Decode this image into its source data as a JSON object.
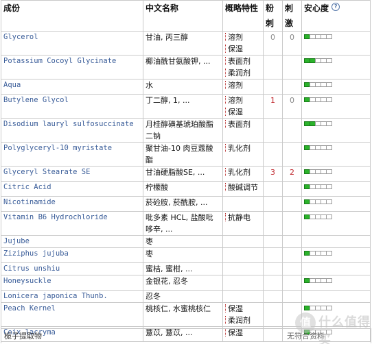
{
  "header": {
    "col_ingredient": "成份",
    "col_chinese": "中文名称",
    "col_category": "概略特性",
    "col_acne": "粉刺",
    "col_irritant": "刺激",
    "col_safety": "安心度",
    "help_icon": "?"
  },
  "colors": {
    "bar_on": "#2bb32b",
    "bar_off": "#ffffff",
    "link": "#3a5d99",
    "alert_number": "#c0282e"
  },
  "rows": [
    {
      "en": "Glycerol",
      "cn": "甘油, 丙三醇",
      "cat": [
        "溶剂",
        "保湿"
      ],
      "acne": "0",
      "irritant": "0",
      "acne_hi": false,
      "irr_hi": false,
      "safety": 1,
      "tall": true
    },
    {
      "en": "Potassium Cocoyl Glycinate",
      "cn": "椰油酰甘氨酸钾, ...",
      "cat": [
        "表面剂",
        "柔润剂"
      ],
      "acne": "",
      "irritant": "",
      "safety": 2,
      "tall": true
    },
    {
      "en": "Aqua",
      "cn": "水",
      "cat": [
        "溶剂"
      ],
      "acne": "",
      "irritant": "",
      "safety": 1,
      "tall": false
    },
    {
      "en": "Butylene Glycol",
      "cn": "丁二醇, 1, ...",
      "cat": [
        "溶剂",
        "保湿"
      ],
      "acne": "1",
      "irritant": "0",
      "acne_hi": true,
      "irr_hi": false,
      "safety": 1,
      "tall": true
    },
    {
      "en": "Disodium lauryl sulfosuccinate",
      "cn": "月桂醇磺基琥珀酸酯二钠",
      "cat": [
        "表面剂"
      ],
      "acne": "",
      "irritant": "",
      "safety": 2,
      "tall": true
    },
    {
      "en": "Polyglyceryl-10 myristate",
      "cn": "聚甘油-10 肉豆蔻酸酯",
      "cat": [
        "乳化剂"
      ],
      "acne": "",
      "irritant": "",
      "safety": 1,
      "tall": false
    },
    {
      "en": "Glyceryl Stearate SE",
      "cn": "甘油硬脂酸SE, ...",
      "cat": [
        "乳化剂"
      ],
      "acne": "3",
      "irritant": "2",
      "acne_hi": true,
      "irr_hi": true,
      "safety": 1,
      "tall": false
    },
    {
      "en": "Citric Acid",
      "cn": "柠檬酸",
      "cat": [
        "酸碱调节"
      ],
      "acne": "",
      "irritant": "",
      "safety": 1,
      "tall": false
    },
    {
      "en": "Nicotinamide",
      "cn": "菸硷胺, 菸酰胺, ...",
      "cat": [],
      "acne": "",
      "irritant": "",
      "safety": 1,
      "tall": false
    },
    {
      "en": "Vitamin B6 Hydrochloride",
      "cn": "吡多素 HCL, 盐酸吡哆辛, ...",
      "cat": [
        "抗静电"
      ],
      "acne": "",
      "irritant": "",
      "safety": 1,
      "tall": true
    },
    {
      "en": "Jujube",
      "cn": "枣",
      "cat": [],
      "acne": "",
      "irritant": "",
      "safety": 0,
      "tall": false
    },
    {
      "en": "Ziziphus jujuba",
      "cn": "枣",
      "cat": [],
      "acne": "",
      "irritant": "",
      "safety": 1,
      "tall": false
    },
    {
      "en": "Citrus unshiu",
      "cn": "蜜桔, 蜜柑, ...",
      "cat": [],
      "acne": "",
      "irritant": "",
      "safety": 0,
      "tall": false
    },
    {
      "en": "Honeysuckle",
      "cn": "金银花, 忍冬",
      "cat": [],
      "acne": "",
      "irritant": "",
      "safety": 1,
      "tall": false
    },
    {
      "en": "Lonicera japonica Thunb.",
      "cn": "忍冬",
      "cat": [],
      "acne": "",
      "irritant": "",
      "safety": 0,
      "tall": false
    },
    {
      "en": "Peach Kernel",
      "cn": "桃核仁, 水蜜桃核仁",
      "cat": [
        "保湿",
        "柔润剂"
      ],
      "acne": "",
      "irritant": "",
      "safety": 1,
      "tall": true
    },
    {
      "en": "Coix lacryma",
      "cn": "薏苡, 薏苡, ...",
      "cat": [
        "保湿"
      ],
      "acne": "",
      "irritant": "",
      "safety": 1,
      "tall": false
    }
  ],
  "footer": {
    "left": "栀子提取物",
    "right": "无符合资料"
  },
  "watermark": {
    "text": "值 什么值得买",
    "badge": "值",
    "label": "什么值得买"
  }
}
